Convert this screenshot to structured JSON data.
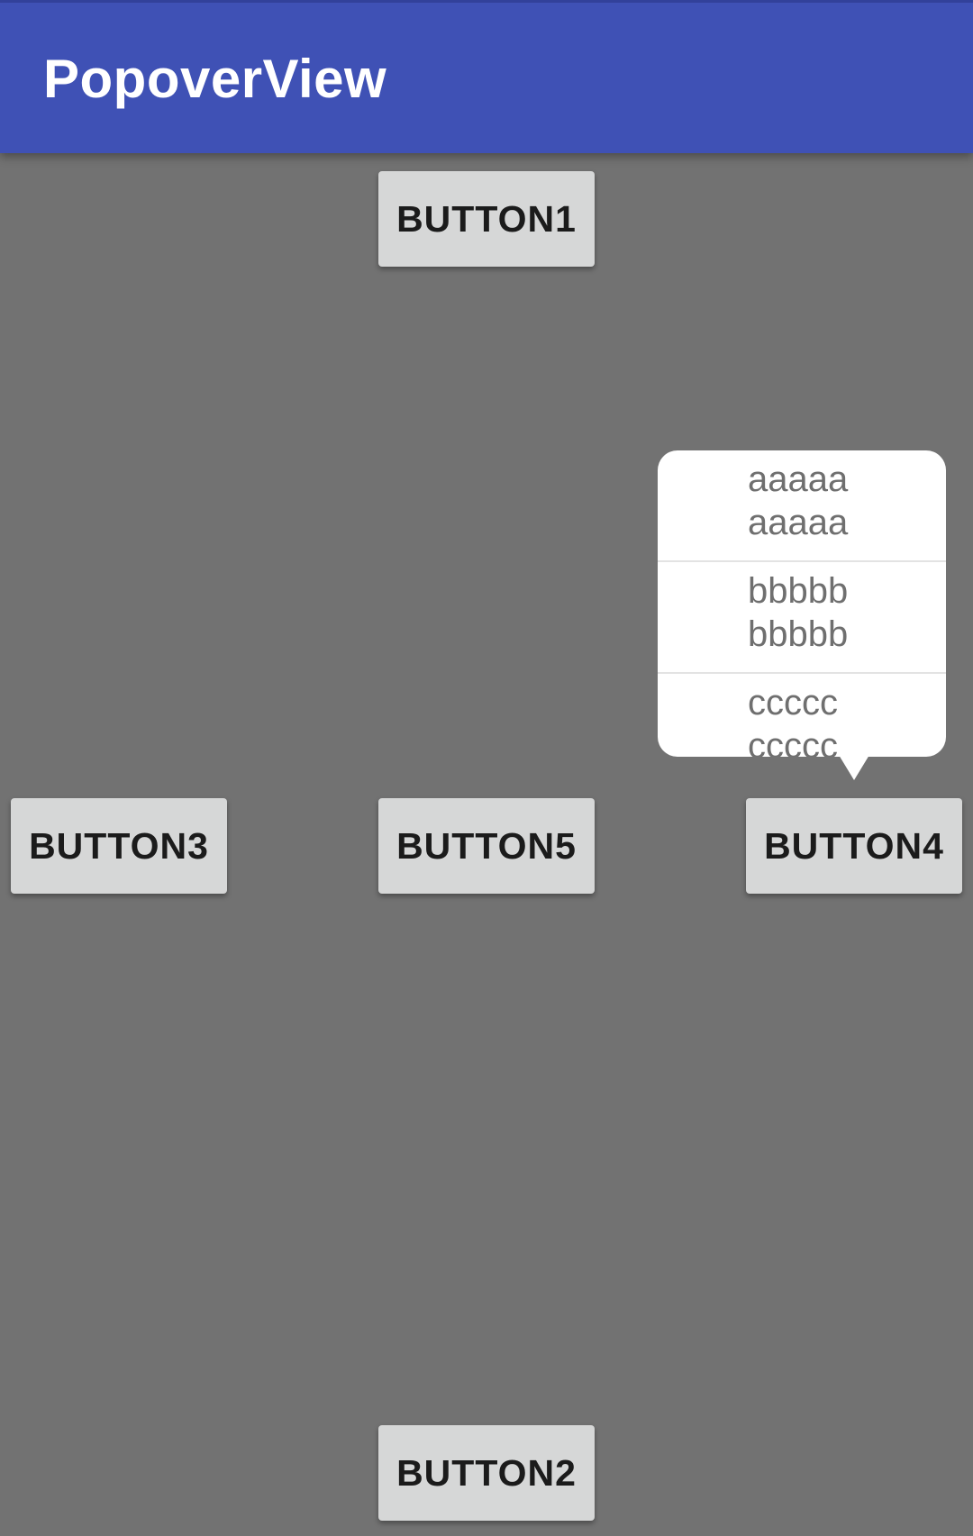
{
  "app_bar": {
    "title": "PopoverView",
    "color": "#3F51B5"
  },
  "background_color": "#727272",
  "buttons": {
    "button1": "BUTTON1",
    "button2": "BUTTON2",
    "button3": "BUTTON3",
    "button4": "BUTTON4",
    "button5": "BUTTON5"
  },
  "popover": {
    "anchor": "BUTTON4",
    "items": [
      "aaaaa\naaaaa",
      "bbbbb\nbbbbb",
      "ccccc\nccccc"
    ]
  }
}
